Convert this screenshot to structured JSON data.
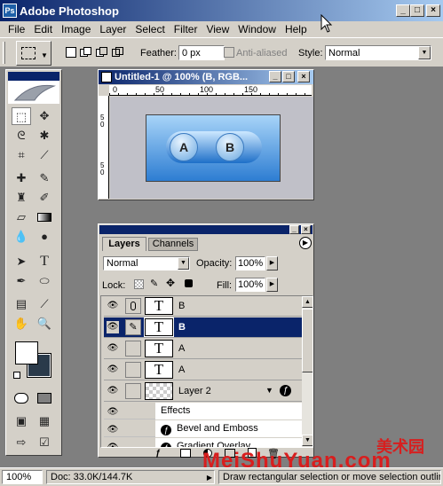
{
  "app": {
    "title": "Adobe Photoshop",
    "icon_text": "Ps"
  },
  "window_buttons": {
    "minimize": "_",
    "maximize": "□",
    "close": "×"
  },
  "menu": [
    "File",
    "Edit",
    "Image",
    "Layer",
    "Select",
    "Filter",
    "View",
    "Window",
    "Help"
  ],
  "options": {
    "feather_label": "Feather:",
    "feather_value": "0 px",
    "anti_aliased_label": "Anti-aliased",
    "style_label": "Style:",
    "style_value": "Normal"
  },
  "document": {
    "title": "Untitled-1 @ 100% (B, RGB...",
    "ruler_top": [
      "0",
      "50",
      "100",
      "150"
    ],
    "ruler_left": [
      "5",
      "0",
      "5",
      "0"
    ],
    "button_a": "A",
    "button_b": "B"
  },
  "layers_panel": {
    "tab_layers": "Layers",
    "tab_channels": "Channels",
    "blend_mode": "Normal",
    "opacity_label": "Opacity:",
    "opacity_value": "100%",
    "lock_label": "Lock:",
    "fill_label": "Fill:",
    "fill_value": "100%",
    "layers": [
      {
        "name": "B",
        "thumb": "T",
        "selected": false
      },
      {
        "name": "B",
        "thumb": "T",
        "selected": true
      },
      {
        "name": "A",
        "thumb": "T",
        "selected": false
      },
      {
        "name": "A",
        "thumb": "T",
        "selected": false
      },
      {
        "name": "Layer 2",
        "thumb": "",
        "selected": false
      }
    ],
    "effects": [
      "Effects",
      "Bevel and Emboss",
      "Gradient Overlay"
    ],
    "fx_glyph": "ƒ"
  },
  "status": {
    "zoom": "100%",
    "doc": "Doc: 33.0K/144.7K",
    "hint": "Draw rectangular selection or move selection outline"
  },
  "watermark": {
    "cn": "美术园",
    "latin": "MeiShuYuan.com"
  },
  "colors": {
    "title_start": "#0a246a",
    "title_end": "#a6caf0",
    "selection": "#0a246a",
    "button_blue": "#2d7dd2",
    "watermark": "#d81e1e"
  }
}
